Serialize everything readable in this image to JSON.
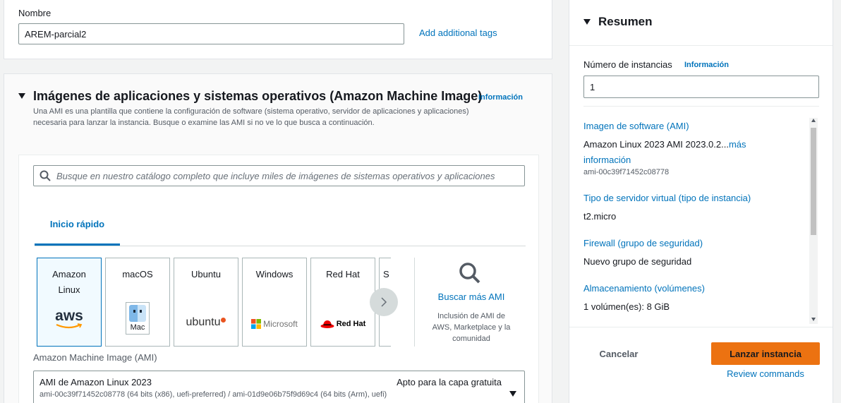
{
  "name_section": {
    "label": "Nombre",
    "value": "AREM-parcial2",
    "add_tags_link": "Add additional tags"
  },
  "ami_section": {
    "title": "Imágenes de aplicaciones y sistemas operativos (Amazon Machine Image)",
    "info_link": "Información",
    "description_line1": "Una AMI es una plantilla que contiene la configuración de software (sistema operativo, servidor de aplicaciones y aplicaciones)",
    "description_line2": "necesaria para lanzar la instancia. Busque o examine las AMI si no ve lo que busca a continuación.",
    "search_placeholder": "Busque en nuestro catálogo completo que incluye miles de imágenes de sistemas operativos y aplicaciones",
    "tab_label": "Inicio rápido",
    "cards": [
      {
        "name_line1": "Amazon",
        "name_line2": "Linux",
        "logo": "aws"
      },
      {
        "name_line1": "macOS",
        "name_line2": "",
        "logo": "Mac"
      },
      {
        "name_line1": "Ubuntu",
        "name_line2": "",
        "logo": "ubuntu"
      },
      {
        "name_line1": "Windows",
        "name_line2": "",
        "logo": "Microsoft"
      },
      {
        "name_line1": "Red Hat",
        "name_line2": "",
        "logo": "Red Hat"
      },
      {
        "name_line1": "S",
        "name_line2": "",
        "logo": ""
      }
    ],
    "browse_more": {
      "title": "Buscar más AMI",
      "desc_line1": "Inclusión de AMI de",
      "desc_line2": "AWS, Marketplace y la",
      "desc_line3": "comunidad"
    },
    "ami_select_label": "Amazon Machine Image (AMI)",
    "ami_select": {
      "name": "AMI de Amazon Linux 2023",
      "badge": "Apto para la capa gratuita",
      "detail": "ami-00c39f71452c08778 (64 bits (x86), uefi-preferred) / ami-01d9e06b75f9d69c4 (64 bits (Arm), uefi)"
    }
  },
  "summary": {
    "title": "Resumen",
    "instances_label": "Número de instancias",
    "instances_info": "Información",
    "instances_value": "1",
    "ami_label": "Imagen de software (AMI)",
    "ami_value": "Amazon Linux 2023 AMI 2023.0.2...",
    "ami_more_1": "más",
    "ami_more_2": "información",
    "ami_id": "ami-00c39f71452c08778",
    "instance_type_label": "Tipo de servidor virtual (tipo de instancia)",
    "instance_type_value": "t2.micro",
    "firewall_label": "Firewall (grupo de seguridad)",
    "firewall_value": "Nuevo grupo de seguridad",
    "storage_label": "Almacenamiento (volúmenes)",
    "storage_value": "1 volúmen(es): 8 GiB",
    "cancel_label": "Cancelar",
    "launch_label": "Lanzar instancia",
    "review_label": "Review commands"
  },
  "colors": {
    "accent": "#0073bb",
    "primary_button": "#ec7211"
  }
}
